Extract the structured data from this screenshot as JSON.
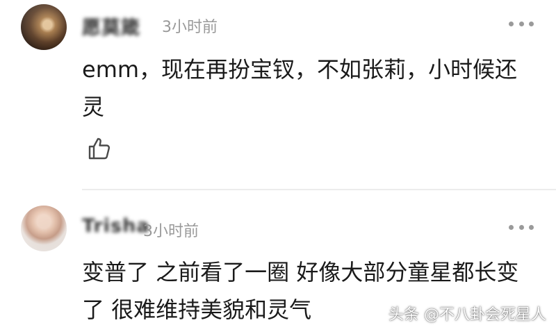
{
  "comments": [
    {
      "username": "愿莫箴",
      "time": "3小时前",
      "text": "emm，现在再扮宝钗，不如张莉，小时候还灵",
      "avatar_icon": "user-avatar-warm-photo",
      "like_icon": "thumbs-up-icon",
      "more_icon": "more-dots-icon"
    },
    {
      "username": "Trisha",
      "time": "3小时前",
      "text": "变普了 之前看了一圈 好像大部分童星都长变了 很难维持美貌和灵气",
      "avatar_icon": "user-avatar-portrait-photo",
      "more_icon": "more-dots-icon"
    }
  ],
  "watermark": "头条 @不八卦会死星人",
  "colors": {
    "text": "#1a1a1a",
    "username": "#333333",
    "time": "#999999",
    "divider": "#ececec"
  }
}
